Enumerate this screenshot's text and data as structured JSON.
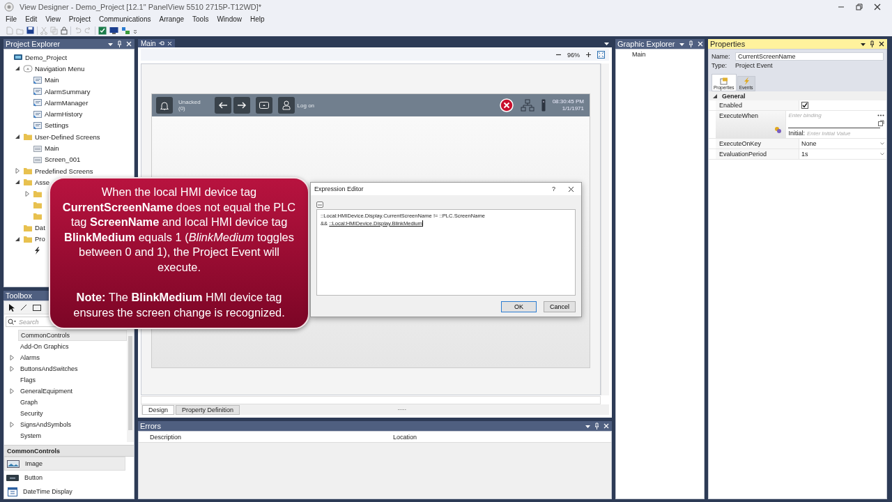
{
  "window": {
    "title": "View Designer - Demo_Project [12.1\" PanelView 5510 2715P-T12WD]*"
  },
  "menu": [
    "File",
    "Edit",
    "View",
    "Project",
    "Communications",
    "Arrange",
    "Tools",
    "Window",
    "Help"
  ],
  "project_explorer": {
    "title": "Project Explorer",
    "tree": [
      {
        "label": "Demo_Project",
        "kind": "project",
        "children": [
          {
            "label": "Navigation Menu",
            "kind": "menu",
            "expanded": true,
            "children": [
              {
                "label": "Main",
                "kind": "screen-link"
              },
              {
                "label": "AlarmSummary",
                "kind": "screen-link"
              },
              {
                "label": "AlarmManager",
                "kind": "screen-link"
              },
              {
                "label": "AlarmHistory",
                "kind": "screen-link"
              },
              {
                "label": "Settings",
                "kind": "screen-link"
              }
            ]
          },
          {
            "label": "User-Defined Screens",
            "kind": "folder",
            "expanded": true,
            "children": [
              {
                "label": "Main",
                "kind": "screen"
              },
              {
                "label": "Screen_001",
                "kind": "screen"
              }
            ]
          },
          {
            "label": "Predefined Screens",
            "kind": "folder",
            "expanded": false
          },
          {
            "label": "Asse",
            "kind": "folder",
            "expanded": true,
            "children": [
              {
                "kind": "folder",
                "expanded": false
              },
              {
                "kind": "folder"
              },
              {
                "kind": "folder"
              }
            ]
          },
          {
            "label": "Dat",
            "kind": "folder"
          },
          {
            "label": "Pro",
            "kind": "folder",
            "expanded": true,
            "children": [
              {
                "kind": "event"
              }
            ]
          }
        ]
      }
    ]
  },
  "toolbox": {
    "title": "Toolbox",
    "search": {
      "placeholder": "Search"
    },
    "categories": [
      {
        "label": "CommonControls",
        "selected": true
      },
      {
        "label": "Add-On Graphics",
        "selected": false
      },
      {
        "label": "Alarms",
        "selected": false,
        "expanded": false
      },
      {
        "label": "ButtonsAndSwitches",
        "selected": false,
        "expanded": false
      },
      {
        "label": "Flags",
        "selected": false
      },
      {
        "label": "GeneralEquipment",
        "selected": false,
        "expanded": false
      },
      {
        "label": "Graph",
        "selected": false
      },
      {
        "label": "Security",
        "selected": false
      },
      {
        "label": "SignsAndSymbols",
        "selected": false,
        "expanded": false
      },
      {
        "label": "System",
        "selected": false
      }
    ],
    "group": {
      "title": "CommonControls",
      "items": [
        {
          "label": "Image",
          "kind": "image",
          "selected": true
        },
        {
          "label": "Button",
          "kind": "button",
          "selected": false
        },
        {
          "label": "DateTime Display",
          "kind": "datetime",
          "selected": false
        }
      ]
    }
  },
  "document": {
    "tabs": [
      {
        "label": "Main",
        "selected": true
      }
    ],
    "zoom": "96%",
    "hmi": {
      "alarm_label": "Unacked",
      "alarm_count": "(0)",
      "logon": "Log on",
      "time": "08:30:45 PM",
      "date": "1/1/1971"
    },
    "view_tabs": [
      {
        "label": "Design",
        "selected": true
      },
      {
        "label": "Property Definition",
        "selected": false
      }
    ]
  },
  "errors": {
    "title": "Errors",
    "columns": [
      "Description",
      "Location"
    ]
  },
  "graphic_explorer": {
    "title": "Graphic Explorer",
    "items": [
      "Main"
    ]
  },
  "properties": {
    "title": "Properties",
    "name_label": "Name:",
    "name": "CurrentScreenName",
    "type_label": "Type:",
    "type": "Project Event",
    "tabs": [
      {
        "label": "Properties",
        "selected": true
      },
      {
        "label": "Events",
        "selected": false
      }
    ],
    "category": {
      "label": "General",
      "expanded": true
    },
    "rows": [
      {
        "kind": "checkbox",
        "label": "Enabled",
        "checked": true
      },
      {
        "kind": "binding",
        "label": "ExecuteWhen",
        "placeholder": "Enter binding",
        "initial_label": "Initial:",
        "initial_placeholder": "Enter Initial Value"
      },
      {
        "kind": "dropdown",
        "label": "ExecuteOnKey",
        "value": "None"
      },
      {
        "kind": "dropdown",
        "label": "EvaluationPeriod",
        "value": "1s"
      }
    ]
  },
  "expression_editor": {
    "title": "Expression Editor",
    "help": "?",
    "lines": [
      [
        {
          "text": "::Local:HMIDevice.Display.CurrentScreenName != ::PLC.ScreenName",
          "underlined": false
        }
      ],
      [
        {
          "text": "&&",
          "underlined": false
        },
        {
          "text": "::Local:HMIDevice.Display.BlinkMedium",
          "underlined": true
        }
      ]
    ],
    "buttons": [
      "OK",
      "Cancel"
    ]
  },
  "callout": {
    "paragraphs": [
      "When the local HMI device tag **CurrentScreenName** does not equal the PLC tag **ScreenName** and local HMI device tag **BlinkMedium** equals 1 (*BlinkMedium* toggles between 0 and 1), the Project Event will execute.",
      "**Note:** The **BlinkMedium** HMI device tag ensures the screen change is recognized."
    ]
  }
}
